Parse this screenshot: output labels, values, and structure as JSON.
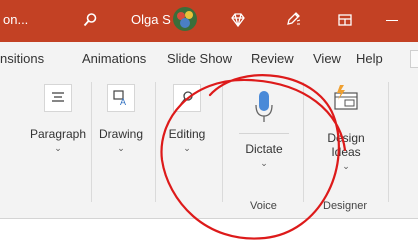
{
  "titlebar": {
    "doc_name": "on...",
    "user_name": "Olga S",
    "bg_color": "#c34124"
  },
  "icons": {
    "search": "search-icon",
    "avatar": "user-avatar",
    "diamond": "diamond-icon",
    "pen": "pen-icon",
    "window": "restore-window-icon",
    "minimize": "minimize-icon",
    "paragraph": "paragraph-icon",
    "drawing": "drawing-icon",
    "editing": "editing-icon",
    "dictate": "microphone-icon",
    "design_ideas": "design-ideas-icon"
  },
  "ribbon": {
    "tabs": [
      "nsitions",
      "Animations",
      "Slide Show",
      "Review",
      "View",
      "Help"
    ]
  },
  "ribbon_body": {
    "paragraph": {
      "label": "Paragraph"
    },
    "drawing": {
      "label": "Drawing"
    },
    "editing": {
      "label": "Editing"
    },
    "dictate": {
      "label": "Dictate",
      "accent": "#4a8ad8"
    },
    "design_ideas": {
      "label_line1": "Design",
      "label_line2": "Ideas",
      "accent": "#f0a030"
    },
    "groups": {
      "voice": "Voice",
      "designer": "Designer"
    }
  },
  "annotation": {
    "color": "#dd1a1a"
  }
}
